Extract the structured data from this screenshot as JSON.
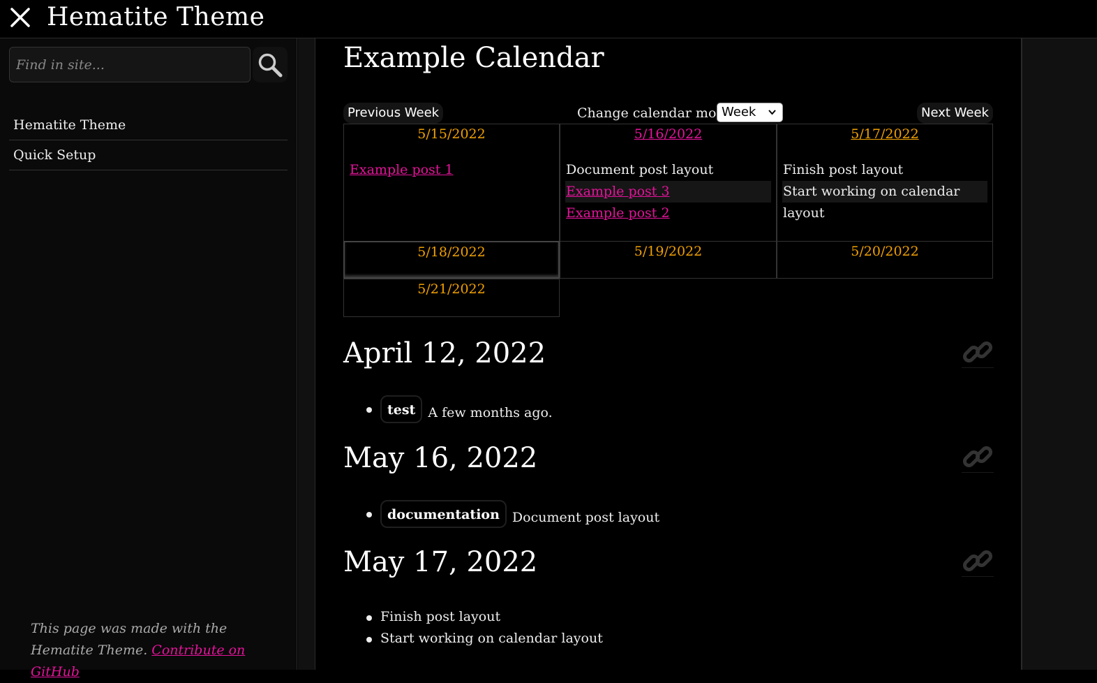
{
  "header": {
    "title": "Hematite Theme",
    "close_icon": "close-icon"
  },
  "sidebar": {
    "search_placeholder": "Find in site...",
    "search_icon": "search-icon",
    "items": [
      {
        "label": "Hematite Theme"
      },
      {
        "label": "Quick Setup"
      }
    ],
    "footer_text": "This page was made with the Hematite Theme.",
    "footer_link": "Contribute on GitHub"
  },
  "main": {
    "title": "Example Calendar",
    "prev_label": "Previous Week",
    "next_label": "Next Week",
    "mode_label": "Change calendar mode:",
    "mode_value": "Week",
    "days": [
      {
        "date": "5/15/2022",
        "entries": [
          "Example post 1"
        ]
      },
      {
        "date": "5/16/2022",
        "entries": [
          "Document post layout",
          "Example post 3",
          "Example post 2"
        ]
      },
      {
        "date": "5/17/2022",
        "entries": [
          "Finish post layout",
          "Start working on calendar layout"
        ]
      },
      {
        "date": "5/18/2022",
        "entries": []
      },
      {
        "date": "5/19/2022",
        "entries": []
      },
      {
        "date": "5/20/2022",
        "entries": []
      },
      {
        "date": "5/21/2022",
        "entries": []
      }
    ],
    "sections": [
      {
        "heading": "April 12, 2022",
        "items": [
          {
            "tag": "test",
            "text": "A few months ago."
          }
        ]
      },
      {
        "heading": "May 16, 2022",
        "items": [
          {
            "tag": "documentation",
            "text": "Document post layout"
          }
        ]
      },
      {
        "heading": "May 17, 2022",
        "items": [
          {
            "text": "Finish post layout"
          },
          {
            "text": "Start working on calendar layout"
          }
        ]
      }
    ]
  },
  "colors": {
    "accent_link": "#e5139b",
    "date_orange": "#f0a000",
    "background": "#000000"
  }
}
